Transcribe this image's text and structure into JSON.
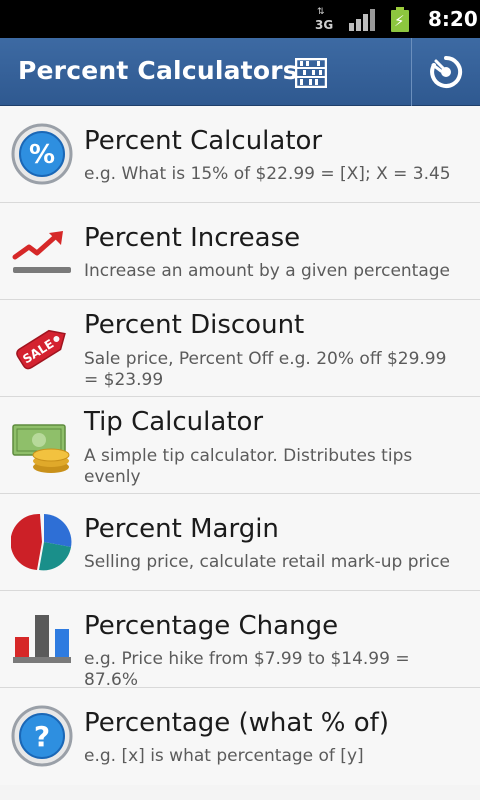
{
  "status_bar": {
    "network_label": "3G",
    "network_arrows": "⇅",
    "time": "8:20"
  },
  "app_bar": {
    "title": "Percent Calculators"
  },
  "colors": {
    "title_bar": "#3a66a0",
    "list_background": "#f7f7f7",
    "title_text": "#1b1b1b",
    "desc_text": "#5b5b5b",
    "battery_green": "#8dc63f"
  },
  "items": [
    {
      "title": "Percent Calculator",
      "desc": "e.g. What is 15% of $22.99 = [X]; X = 3.45",
      "icon": "percent-circle-icon"
    },
    {
      "title": "Percent Increase",
      "desc": "Increase an amount by a given percentage",
      "icon": "trend-up-icon"
    },
    {
      "title": "Percent Discount",
      "desc": "Sale price, Percent Off e.g. 20% off $29.99 = $23.99",
      "icon": "sale-tag-icon",
      "icon_text": "SALE"
    },
    {
      "title": "Tip Calculator",
      "desc": "A simple tip calculator. Distributes tips evenly",
      "icon": "money-coins-icon"
    },
    {
      "title": "Percent Margin",
      "desc": "Selling price, calculate retail mark-up price",
      "icon": "pie-chart-icon"
    },
    {
      "title": "Percentage Change",
      "desc": "e.g. Price hike from $7.99 to $14.99 = 87.6%",
      "icon": "bar-chart-icon"
    },
    {
      "title": "Percentage (what % of)",
      "desc": "e.g. [x] is what percentage of [y]",
      "icon": "question-circle-icon"
    }
  ]
}
